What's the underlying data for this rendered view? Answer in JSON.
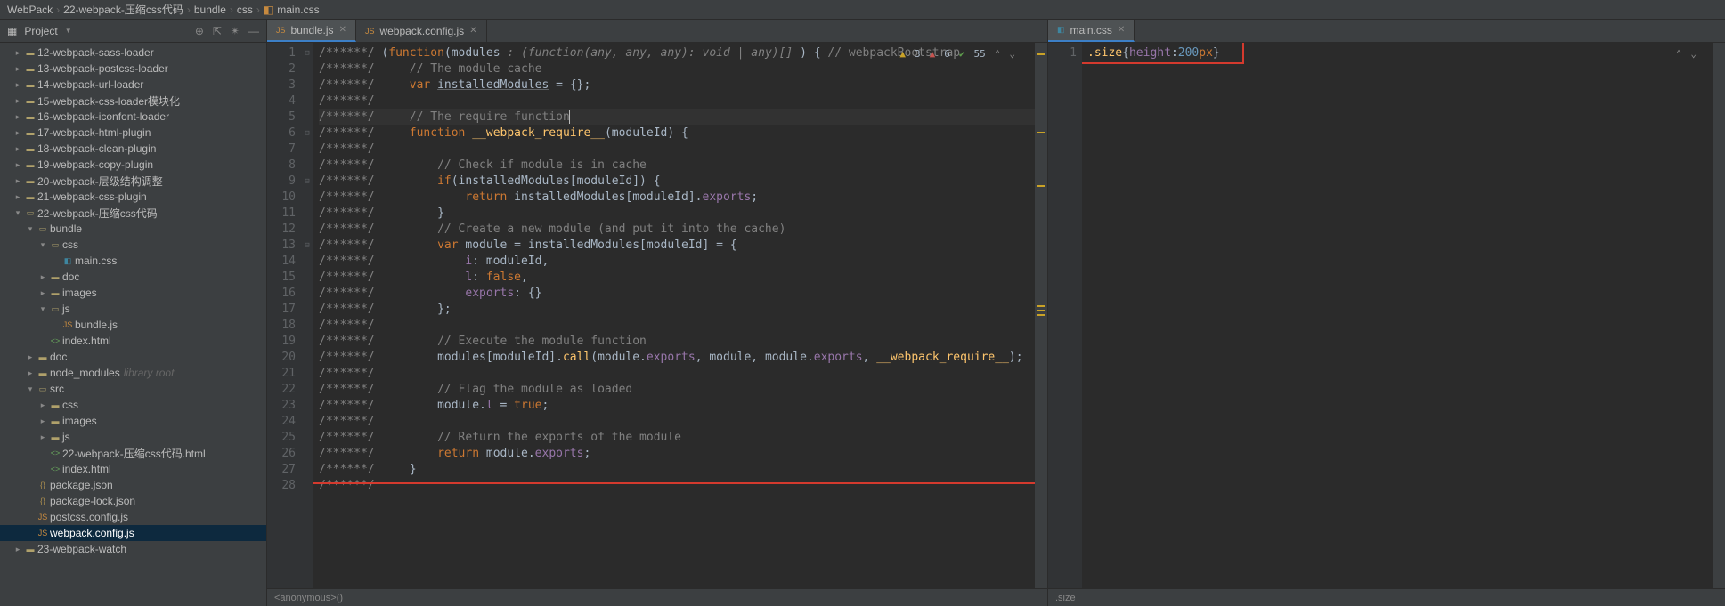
{
  "breadcrumb": [
    "WebPack",
    "22-webpack-压缩css代码",
    "bundle",
    "css",
    "main.css"
  ],
  "breadcrumb_icon": "css",
  "sidebar": {
    "title": "Project",
    "tree": [
      {
        "depth": 1,
        "arrow": "right",
        "ico": "folder",
        "label": "12-webpack-sass-loader"
      },
      {
        "depth": 1,
        "arrow": "right",
        "ico": "folder",
        "label": "13-webpack-postcss-loader"
      },
      {
        "depth": 1,
        "arrow": "right",
        "ico": "folder",
        "label": "14-webpack-url-loader"
      },
      {
        "depth": 1,
        "arrow": "right",
        "ico": "folder",
        "label": "15-webpack-css-loader模块化"
      },
      {
        "depth": 1,
        "arrow": "right",
        "ico": "folder",
        "label": "16-webpack-iconfont-loader"
      },
      {
        "depth": 1,
        "arrow": "right",
        "ico": "folder",
        "label": "17-webpack-html-plugin"
      },
      {
        "depth": 1,
        "arrow": "right",
        "ico": "folder",
        "label": "18-webpack-clean-plugin"
      },
      {
        "depth": 1,
        "arrow": "right",
        "ico": "folder",
        "label": "19-webpack-copy-plugin"
      },
      {
        "depth": 1,
        "arrow": "right",
        "ico": "folder",
        "label": "20-webpack-层级结构调整"
      },
      {
        "depth": 1,
        "arrow": "right",
        "ico": "folder",
        "label": "21-webpack-css-plugin"
      },
      {
        "depth": 1,
        "arrow": "down",
        "ico": "folder-open",
        "label": "22-webpack-压缩css代码"
      },
      {
        "depth": 2,
        "arrow": "down",
        "ico": "folder-open",
        "label": "bundle"
      },
      {
        "depth": 3,
        "arrow": "down",
        "ico": "folder-open",
        "label": "css"
      },
      {
        "depth": 4,
        "arrow": "none",
        "ico": "css",
        "label": "main.css"
      },
      {
        "depth": 3,
        "arrow": "right",
        "ico": "folder",
        "label": "doc"
      },
      {
        "depth": 3,
        "arrow": "right",
        "ico": "folder",
        "label": "images"
      },
      {
        "depth": 3,
        "arrow": "down",
        "ico": "folder-open",
        "label": "js"
      },
      {
        "depth": 4,
        "arrow": "none",
        "ico": "js",
        "label": "bundle.js"
      },
      {
        "depth": 3,
        "arrow": "none",
        "ico": "html",
        "label": "index.html"
      },
      {
        "depth": 2,
        "arrow": "right",
        "ico": "folder",
        "label": "doc"
      },
      {
        "depth": 2,
        "arrow": "right",
        "ico": "folder",
        "label": "node_modules",
        "faint": "library root"
      },
      {
        "depth": 2,
        "arrow": "down",
        "ico": "folder-open",
        "label": "src"
      },
      {
        "depth": 3,
        "arrow": "right",
        "ico": "folder",
        "label": "css"
      },
      {
        "depth": 3,
        "arrow": "right",
        "ico": "folder",
        "label": "images"
      },
      {
        "depth": 3,
        "arrow": "right",
        "ico": "folder",
        "label": "js"
      },
      {
        "depth": 3,
        "arrow": "none",
        "ico": "html",
        "label": "22-webpack-压缩css代码.html"
      },
      {
        "depth": 3,
        "arrow": "none",
        "ico": "html",
        "label": "index.html"
      },
      {
        "depth": 2,
        "arrow": "none",
        "ico": "json",
        "label": "package.json"
      },
      {
        "depth": 2,
        "arrow": "none",
        "ico": "json",
        "label": "package-lock.json"
      },
      {
        "depth": 2,
        "arrow": "none",
        "ico": "js",
        "label": "postcss.config.js"
      },
      {
        "depth": 2,
        "arrow": "none",
        "ico": "js",
        "label": "webpack.config.js",
        "selected": true
      },
      {
        "depth": 1,
        "arrow": "right",
        "ico": "folder",
        "label": "23-webpack-watch"
      }
    ]
  },
  "left_editor": {
    "tabs": [
      {
        "label": "bundle.js",
        "ico": "js",
        "active": true
      },
      {
        "label": "webpack.config.js",
        "ico": "js",
        "active": false
      }
    ],
    "status": {
      "warn": "3",
      "err": "6",
      "ok": "55"
    },
    "footer": "<anonymous>()",
    "lines": [
      {
        "n": 1,
        "fold": "-",
        "html": "<span class='c-comment'>/******/</span> (<span class='c-keyword'>function</span>(modules <span class='c-param'>: (function(any, any, any): void | any)[]</span> ) { <span class='c-comment'>// webpackBootstrap</span>"
      },
      {
        "n": 2,
        "html": "<span class='c-comment'>/******/</span>     <span class='c-comment'>// The module cache</span>"
      },
      {
        "n": 3,
        "html": "<span class='c-comment'>/******/</span>     <span class='c-keyword'>var</span> <span class='c-underline'>installedModules</span> = {};"
      },
      {
        "n": 4,
        "html": "<span class='c-comment'>/******/</span>"
      },
      {
        "n": 5,
        "caret": true,
        "html": "<span class='c-comment'>/******/</span>     <span class='c-comment'>// The require function</span><span class='caret'></span>"
      },
      {
        "n": 6,
        "fold": "-",
        "html": "<span class='c-comment'>/******/</span>     <span class='c-keyword'>function</span> <span class='c-func'>__webpack_require__</span>(moduleId) {"
      },
      {
        "n": 7,
        "html": "<span class='c-comment'>/******/</span>"
      },
      {
        "n": 8,
        "html": "<span class='c-comment'>/******/</span>         <span class='c-comment'>// Check if module is in cache</span>"
      },
      {
        "n": 9,
        "fold": "-",
        "html": "<span class='c-comment'>/******/</span>         <span class='c-keyword'>if</span>(installedModules[moduleId]) {"
      },
      {
        "n": 10,
        "html": "<span class='c-comment'>/******/</span>             <span class='c-keyword'>return</span> installedModules[moduleId].<span class='c-prop'>exports</span>;"
      },
      {
        "n": 11,
        "html": "<span class='c-comment'>/******/</span>         }"
      },
      {
        "n": 12,
        "html": "<span class='c-comment'>/******/</span>         <span class='c-comment'>// Create a new module (and put it into the cache)</span>"
      },
      {
        "n": 13,
        "fold": "-",
        "html": "<span class='c-comment'>/******/</span>         <span class='c-keyword'>var</span> module = installedModules[moduleId] = {"
      },
      {
        "n": 14,
        "html": "<span class='c-comment'>/******/</span>             <span class='c-prop'>i</span>: moduleId,"
      },
      {
        "n": 15,
        "html": "<span class='c-comment'>/******/</span>             <span class='c-prop'>l</span>: <span class='c-keyword'>false</span>,"
      },
      {
        "n": 16,
        "html": "<span class='c-comment'>/******/</span>             <span class='c-prop'>exports</span>: {}"
      },
      {
        "n": 17,
        "html": "<span class='c-comment'>/******/</span>         };"
      },
      {
        "n": 18,
        "html": "<span class='c-comment'>/******/</span>"
      },
      {
        "n": 19,
        "html": "<span class='c-comment'>/******/</span>         <span class='c-comment'>// Execute the module function</span>"
      },
      {
        "n": 20,
        "html": "<span class='c-comment'>/******/</span>         modules[moduleId].<span class='c-func'>call</span>(module.<span class='c-prop'>exports</span>, module, module.<span class='c-prop'>exports</span>, <span class='c-func'>__webpack_require__</span>);"
      },
      {
        "n": 21,
        "html": "<span class='c-comment'>/******/</span>"
      },
      {
        "n": 22,
        "html": "<span class='c-comment'>/******/</span>         <span class='c-comment'>// Flag the module as loaded</span>"
      },
      {
        "n": 23,
        "html": "<span class='c-comment'>/******/</span>         module.<span class='c-prop'>l</span> = <span class='c-keyword'>true</span>;"
      },
      {
        "n": 24,
        "html": "<span class='c-comment'>/******/</span>"
      },
      {
        "n": 25,
        "html": "<span class='c-comment'>/******/</span>         <span class='c-comment'>// Return the exports of the module</span>"
      },
      {
        "n": 26,
        "html": "<span class='c-comment'>/******/</span>         <span class='c-keyword'>return</span> module.<span class='c-prop'>exports</span>;"
      },
      {
        "n": 27,
        "html": "<span class='c-comment'>/******/</span>     }"
      },
      {
        "n": 28,
        "html": "<span class='c-comment'>/******/</span>"
      }
    ]
  },
  "right_editor": {
    "tabs": [
      {
        "label": "main.css",
        "ico": "css",
        "active": true
      }
    ],
    "footer": ".size",
    "lines": [
      {
        "n": 1,
        "html": "<span class='c-func'>.size</span>{<span class='c-prop'>height</span>:<span class='c-num'>200</span><span class='c-keyword'>px</span>}"
      }
    ]
  }
}
